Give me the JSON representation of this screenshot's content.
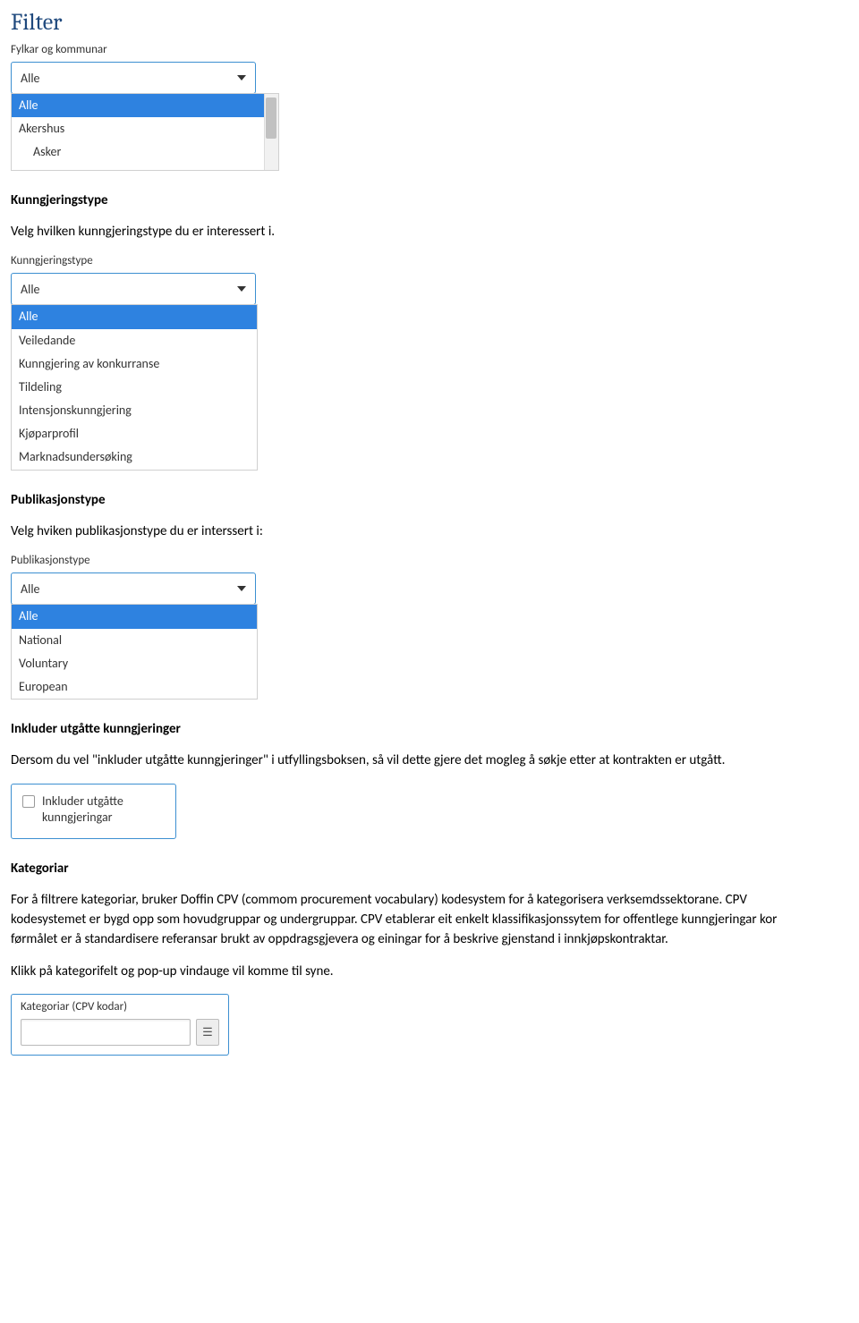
{
  "filter": {
    "title": "Filter",
    "fylkar": {
      "label": "Fylkar og kommunar",
      "selected": "Alle",
      "options": [
        "Alle",
        "Akershus",
        "Asker"
      ],
      "selected_index": 0
    }
  },
  "kunngjeringstype": {
    "heading": "Kunngjeringstype",
    "intro": "Velg hvilken kunngjeringstype du er interessert i.",
    "widget": {
      "label": "Kunngjeringstype",
      "selected": "Alle",
      "options": [
        "Alle",
        "Veiledande",
        "Kunngjering av konkurranse",
        "Tildeling",
        "Intensjonskunngjering",
        "Kjøparprofil",
        "Marknadsundersøking"
      ],
      "selected_index": 0
    }
  },
  "publikasjonstype": {
    "heading": "Publikasjonstype",
    "intro": "Velg hviken publikasjonstype du er interssert i:",
    "widget": {
      "label": "Publikasjonstype",
      "selected": "Alle",
      "options": [
        "Alle",
        "National",
        "Voluntary",
        "European"
      ],
      "selected_index": 0
    }
  },
  "inkluder": {
    "heading": "Inkluder utgåtte kunngjeringer",
    "intro": "Dersom du vel \"inkluder utgåtte kunngjeringer\" i utfyllingsboksen, så vil dette gjere det mogleg  å søkje etter at kontrakten er utgått.",
    "checkbox_label": "Inkluder utgåtte kunngjeringar",
    "checked": false
  },
  "kategoriar": {
    "heading": "Kategoriar",
    "p1": "For å filtrere kategoriar, bruker Doffin CPV (commom procurement vocabulary) kodesystem for å kategorisera verksemdssektorane. CPV kodesystemet er bygd opp som hovudgruppar og undergruppar. CPV etablerar eit enkelt klassifikasjonssytem for offentlege kunngjeringar kor førmålet er å standardisere referansar brukt av oppdragsgjevera og einingar for å beskrive gjenstand i innkjøpskontraktar.",
    "p2": "Klikk på kategorifelt og pop-up vindauge vil komme til syne.",
    "widget": {
      "label": "Kategoriar (CPV kodar)",
      "value": ""
    }
  }
}
